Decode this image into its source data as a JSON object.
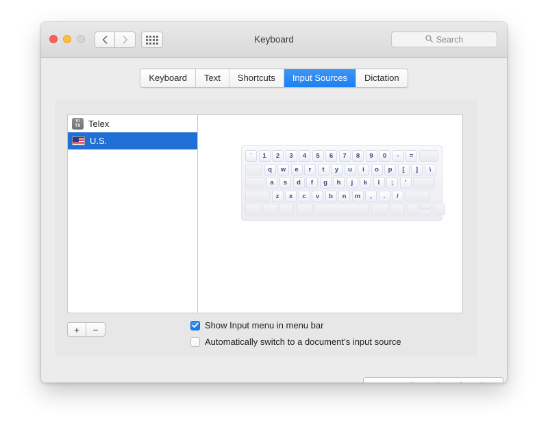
{
  "window": {
    "title": "Keyboard",
    "traffic_lights": [
      "close",
      "minimize",
      "zoom"
    ],
    "nav_back_icon": "chevron-left-icon",
    "nav_forward_icon": "chevron-right-icon",
    "grid_icon": "show-all-grid-icon",
    "accent_color": "#1c7ff2",
    "selection_color": "#1f6fd5"
  },
  "search": {
    "placeholder": "Search",
    "value": "",
    "icon": "search-icon"
  },
  "tabs": [
    {
      "label": "Keyboard",
      "active": false
    },
    {
      "label": "Text",
      "active": false
    },
    {
      "label": "Shortcuts",
      "active": false
    },
    {
      "label": "Input Sources",
      "active": true
    },
    {
      "label": "Dictation",
      "active": false
    }
  ],
  "input_sources": [
    {
      "label": "Telex",
      "icon": "telex-badge-icon",
      "icon_text_top": "VI",
      "icon_text_bottom": "TX",
      "selected": false
    },
    {
      "label": "U.S.",
      "icon": "us-flag-icon",
      "selected": true
    }
  ],
  "list_controls": {
    "add_label": "+",
    "remove_label": "−"
  },
  "checkboxes": [
    {
      "label": "Show Input menu in menu bar",
      "checked": true
    },
    {
      "label": "Automatically switch to a document’s input source",
      "checked": false
    }
  ],
  "footer": {
    "bluetooth_button": "Set Up Bluetooth Keyboard…",
    "help_button": "?"
  },
  "keyboard_preview": {
    "layout_name": "U.S.",
    "rows": [
      {
        "keys": [
          {
            "label": "`",
            "w": "w17"
          },
          {
            "label": "1",
            "w": "w17"
          },
          {
            "label": "2",
            "w": "w17"
          },
          {
            "label": "3",
            "w": "w17"
          },
          {
            "label": "4",
            "w": "w17"
          },
          {
            "label": "5",
            "w": "w17"
          },
          {
            "label": "6",
            "w": "w17"
          },
          {
            "label": "7",
            "w": "w17"
          },
          {
            "label": "8",
            "w": "w17"
          },
          {
            "label": "9",
            "w": "w17"
          },
          {
            "label": "0",
            "w": "w17"
          },
          {
            "label": "-",
            "w": "w17"
          },
          {
            "label": "=",
            "w": "w17"
          },
          {
            "label": "",
            "w": "w28",
            "blank": true
          }
        ]
      },
      {
        "keys": [
          {
            "label": "",
            "w": "w25",
            "blank": true
          },
          {
            "label": "q",
            "w": "w17"
          },
          {
            "label": "w",
            "w": "w17"
          },
          {
            "label": "e",
            "w": "w17"
          },
          {
            "label": "r",
            "w": "w17"
          },
          {
            "label": "t",
            "w": "w17"
          },
          {
            "label": "y",
            "w": "w17"
          },
          {
            "label": "u",
            "w": "w17"
          },
          {
            "label": "i",
            "w": "w17"
          },
          {
            "label": "o",
            "w": "w17"
          },
          {
            "label": "p",
            "w": "w17"
          },
          {
            "label": "[",
            "w": "w17"
          },
          {
            "label": "]",
            "w": "w17"
          },
          {
            "label": "\\",
            "w": "w17"
          }
        ]
      },
      {
        "keys": [
          {
            "label": "",
            "w": "w28",
            "blank": true
          },
          {
            "label": "a",
            "w": "w17"
          },
          {
            "label": "s",
            "w": "w17"
          },
          {
            "label": "d",
            "w": "w17"
          },
          {
            "label": "f",
            "w": "w17"
          },
          {
            "label": "g",
            "w": "w17"
          },
          {
            "label": "h",
            "w": "w17"
          },
          {
            "label": "j",
            "w": "w17"
          },
          {
            "label": "k",
            "w": "w17"
          },
          {
            "label": "l",
            "w": "w17"
          },
          {
            "label": ";",
            "w": "w17"
          },
          {
            "label": "'",
            "w": "w17"
          },
          {
            "label": "",
            "w": "w32",
            "blank": true
          }
        ]
      },
      {
        "keys": [
          {
            "label": "",
            "w": "w36",
            "blank": true
          },
          {
            "label": "z",
            "w": "w17"
          },
          {
            "label": "x",
            "w": "w17"
          },
          {
            "label": "c",
            "w": "w17"
          },
          {
            "label": "v",
            "w": "w17"
          },
          {
            "label": "b",
            "w": "w17"
          },
          {
            "label": "n",
            "w": "w17"
          },
          {
            "label": "m",
            "w": "w17"
          },
          {
            "label": ",",
            "w": "w17"
          },
          {
            "label": ".",
            "w": "w17"
          },
          {
            "label": "/",
            "w": "w17"
          },
          {
            "label": "",
            "w": "w36",
            "blank": true
          }
        ]
      },
      {
        "keys": [
          {
            "label": "",
            "w": "w22",
            "blank": true
          },
          {
            "label": "",
            "w": "w22",
            "blank": true
          },
          {
            "label": "",
            "w": "w22",
            "blank": true
          },
          {
            "label": "",
            "w": "w25",
            "blank": true
          },
          {
            "label": "",
            "w": "w80",
            "blank": true
          },
          {
            "label": "",
            "w": "w25",
            "blank": true
          },
          {
            "label": "",
            "w": "w22",
            "blank": true
          }
        ]
      }
    ]
  }
}
